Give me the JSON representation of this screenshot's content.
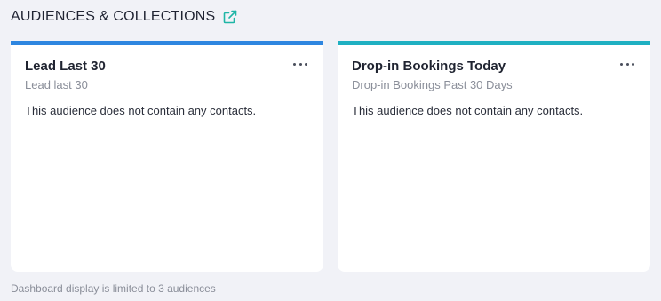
{
  "header": {
    "title": "AUDIENCES & COLLECTIONS",
    "icon": "external-link-icon",
    "icon_color": "#1fb5a6"
  },
  "cards": [
    {
      "title": "Lead Last 30",
      "subtitle": "Lead last 30",
      "message": "This audience does not contain any contacts.",
      "accent_color": "#2e86e0",
      "menu_icon": "more-horizontal-icon"
    },
    {
      "title": "Drop-in Bookings Today",
      "subtitle": "Drop-in Bookings Past 30 Days",
      "message": "This audience does not contain any contacts.",
      "accent_color": "#1fb0c2",
      "menu_icon": "more-horizontal-icon"
    }
  ],
  "footer": {
    "note": "Dashboard display is limited to 3 audiences"
  }
}
